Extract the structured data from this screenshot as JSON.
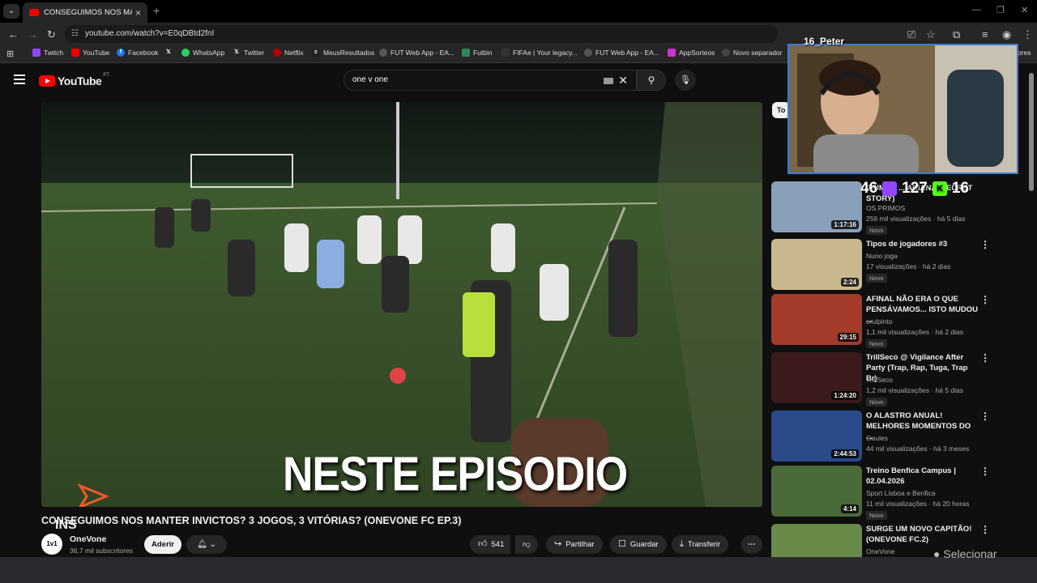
{
  "browser": {
    "tab_title": "CONSEGUIMOS NOS MANTER",
    "url": "youtube.com/watch?v=E0qDBtd2fnI",
    "bookmarks": [
      "Twitch",
      "YouTube",
      "Facebook",
      "",
      "WhatsApp",
      "Twitter",
      "Netflix",
      "MeusResultados",
      "FUT Web App - EA...",
      "Futbin",
      "FIFAe | Your legacy...",
      "FUT Web App - EA...",
      "AppSorteos",
      "Novo separador"
    ],
    "bookmark_more": "ores"
  },
  "youtube": {
    "logo_text": "YouTube",
    "logo_region": "PT",
    "search_value": "one v one"
  },
  "video": {
    "overlay_text": "NESTE EPISODIO",
    "watermark": "INS",
    "title": "CONSEGUIMOS NOS MANTER INVICTOS? 3 JOGOS, 3 VITÓRIAS? (ONEVONE FC EP.3)",
    "channel_avatar": "1v1",
    "channel_name": "OneVone",
    "subscribers": "36,7 mil subscritores",
    "join_label": "Aderir",
    "likes": "541",
    "share_label": "Partilhar",
    "save_label": "Guardar",
    "download_label": "Transferir"
  },
  "overlay": {
    "streamer_name": "16_Peter",
    "stat1": "46",
    "stat2": "127",
    "stat3": "16"
  },
  "sidebar": {
    "filter_chip": "To",
    "recommendations": [
      {
        "title": "PRIMOS ... ARIANA (SECRET STORY)",
        "channel": "OS PRIMOS",
        "meta": "256 mil visualizações · há 5 dias",
        "badge": "Novo",
        "duration": "1:17:16",
        "color": "#8aa0b8"
      },
      {
        "title": "Tipos de jogadores #3",
        "channel": "Nuno joga",
        "meta": "17 visualizações · há 2 dias",
        "badge": "Novo",
        "duration": "2:24",
        "color": "#c9b88e"
      },
      {
        "title": "AFINAL NÃO ERA O QUE PENSÁVAMOS... ISTO MUDOU ...",
        "channel": "orulpinto",
        "meta": "1,1 mil visualizações · há 2 dias",
        "badge": "Novo",
        "duration": "29:15",
        "color": "#a33a2a"
      },
      {
        "title": "TrillSeco @ Vigilance After Party (Trap, Rap, Tuga, Trap Br)",
        "channel": "TrillSeco",
        "meta": "1,2 mil visualizações · há 5 dias",
        "badge": "Novo",
        "duration": "1:24:20",
        "color": "#3a1a1a"
      },
      {
        "title": "O ALASTRO ANUAL! MELHORES MOMENTOS DO ...",
        "channel": "Gaules",
        "meta": "44 mil visualizações · há 3 meses",
        "badge": "",
        "duration": "2:44:53",
        "color": "#2a4a8a"
      },
      {
        "title": "Treino Benfica Campus | 02.04.2026",
        "channel": "Sport Lisboa e Benfica",
        "meta": "11 mil visualizações · há 20 horas",
        "badge": "Novo",
        "duration": "4:14",
        "color": "#4a6a3a"
      },
      {
        "title": "SURGE UM NOVO CAPITÃO! (ONEVONE FC.2)",
        "channel": "OneVone",
        "meta": "",
        "badge": "",
        "duration": "",
        "color": "#6a8a4a"
      }
    ]
  },
  "taskbar": {
    "select_label": "Selecionar"
  }
}
